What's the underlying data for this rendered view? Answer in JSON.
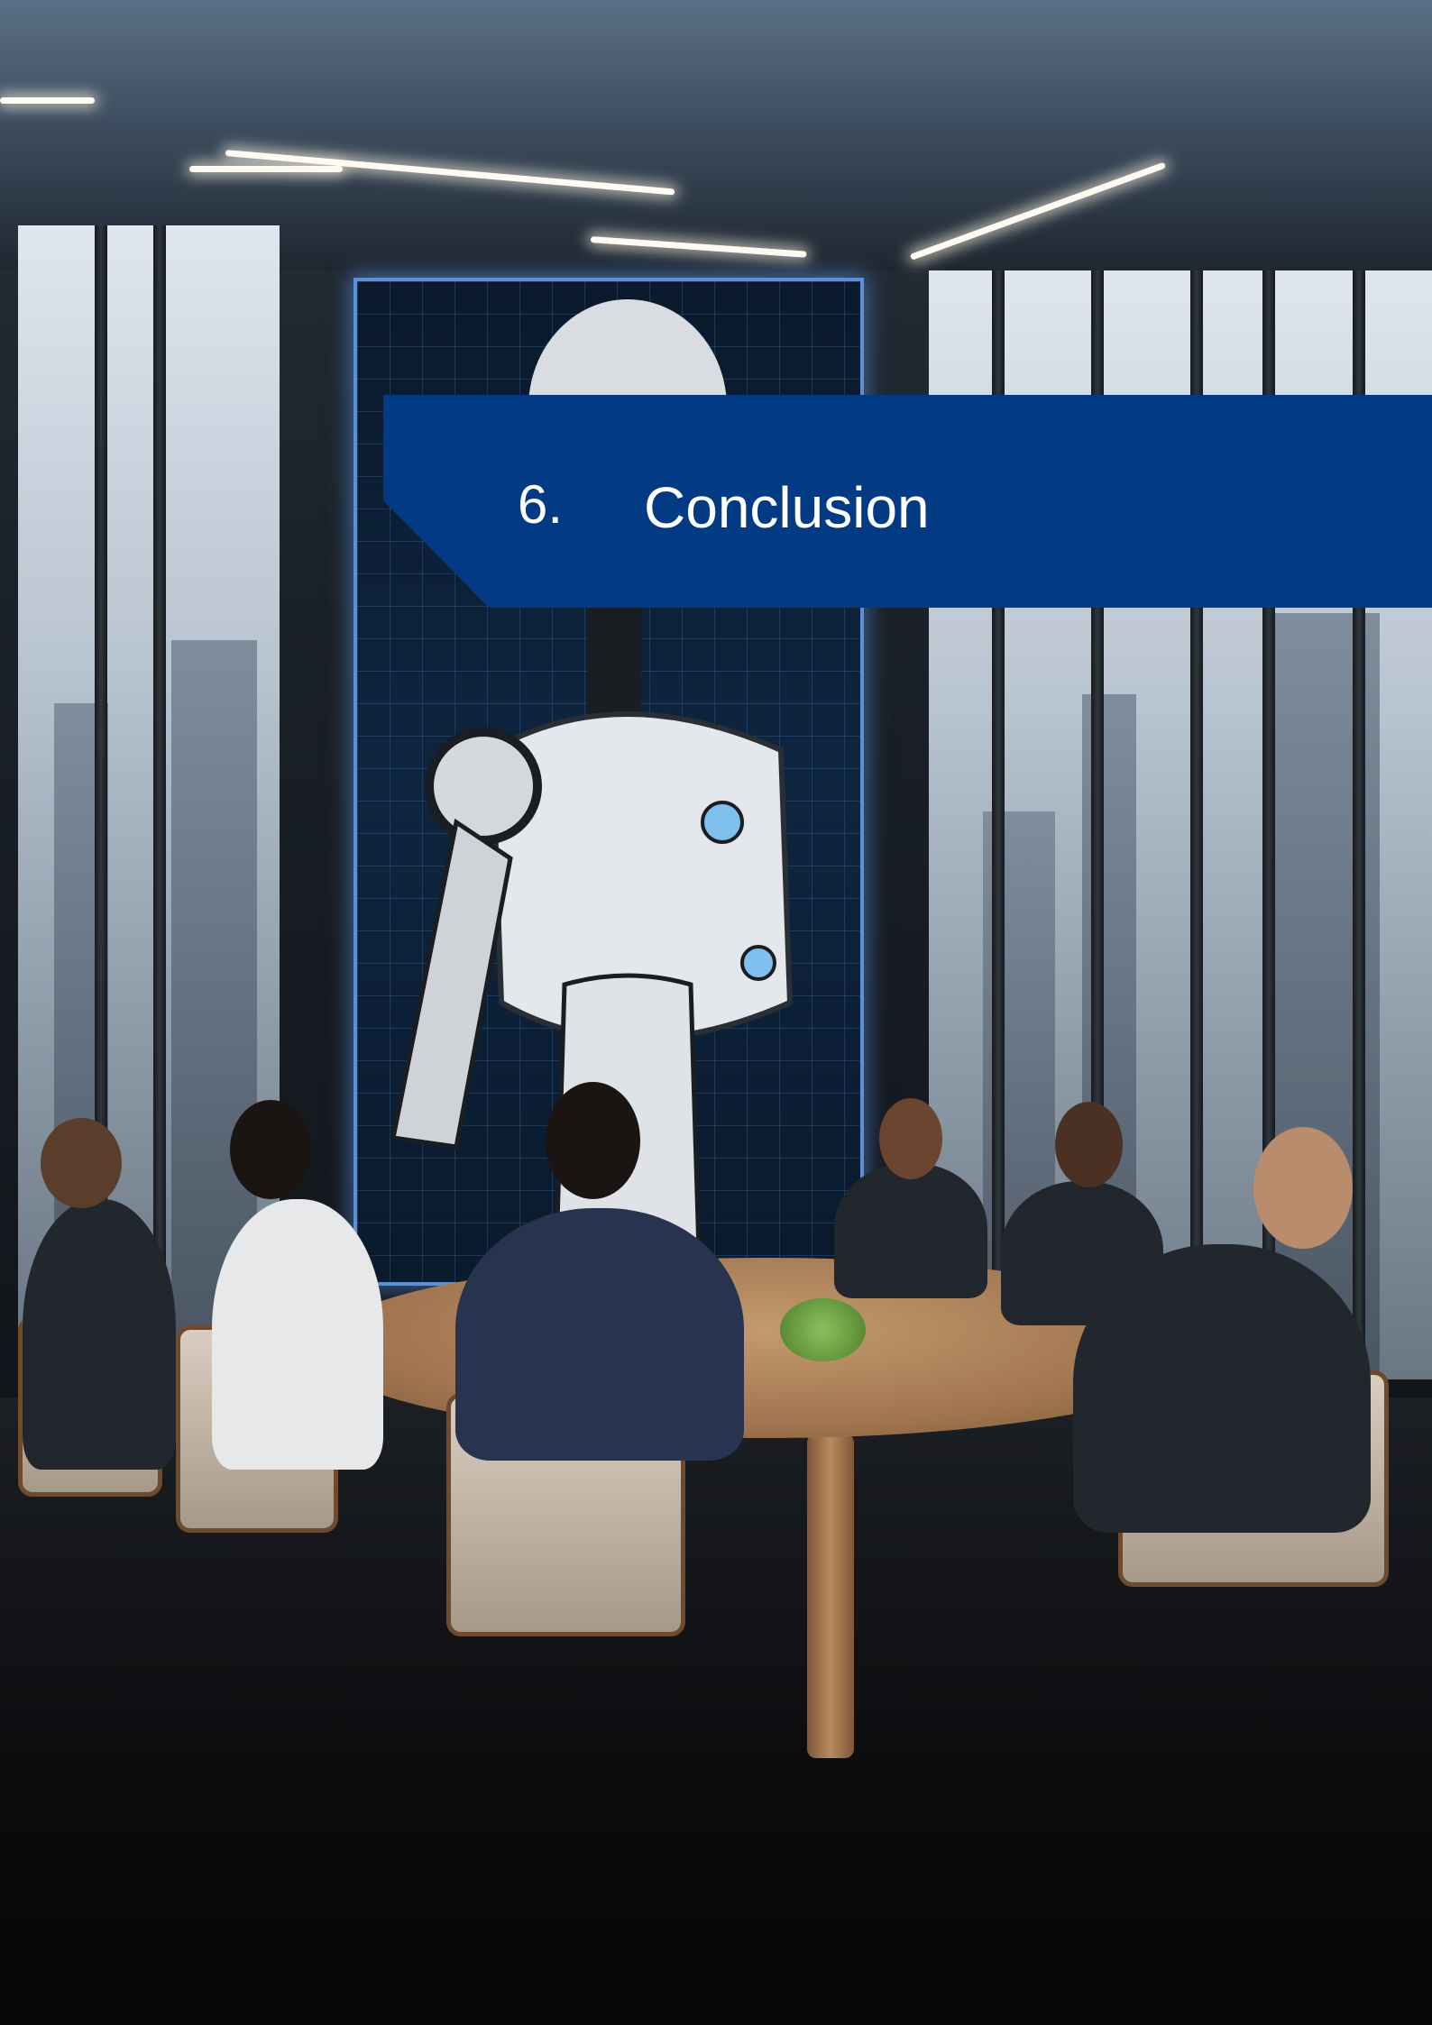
{
  "section": {
    "number": "6.",
    "title": "Conclusion"
  },
  "colors": {
    "banner_background": "#033a84",
    "banner_text": "#ffffff"
  },
  "cover_image": {
    "subject": "office-meeting-with-robot-screen"
  }
}
